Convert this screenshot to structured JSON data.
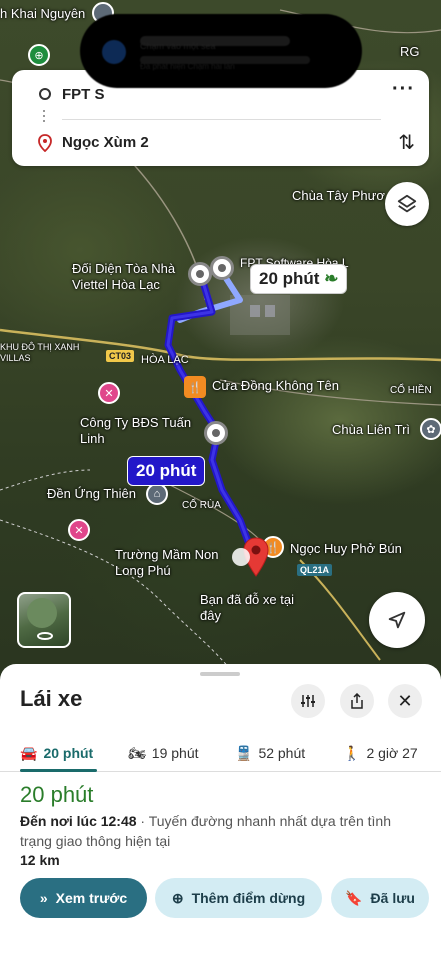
{
  "directions": {
    "origin": "FPT S",
    "destination": "Ngọc Xùm 2"
  },
  "notification": {
    "line1": "Chạm vào một sea",
    "line2": "Đã phát hiện Chạm hai lần"
  },
  "map": {
    "places": {
      "khai_nguyen": "h Khai Nguyên",
      "doi_dien": "Đối Diện Tòa Nhà Viettel Hòa Lạc",
      "fpt_software": "FPT Software Hòa L",
      "chua_tay_phuong": "Chùa Tây Phươ",
      "do_thi": "KHU ĐÔ THỊ XANH VILLAS",
      "hoa_lac": "HÒA LẠC",
      "cua_dong": "Cửa Đồng Không Tên",
      "co_hien": "CỔ HIỀN",
      "bds": "Công Ty BĐS Tuấn Linh",
      "chua_lien_tri": "Chùa Liên Trì",
      "den_ung_thien": "Đền Ứng Thiên",
      "co_rua": "CỔ RÙA",
      "ngoc_huy": "Ngọc Huy Phở Bún",
      "truong_mam_non": "Trường Mầm Non Long Phú",
      "parked": "Bạn đã đỗ xe tại đây",
      "rg": "RG"
    },
    "roads": {
      "ct03": "CT03",
      "ql21a": "QL21A"
    },
    "route_times": {
      "alt": "20 phút",
      "main": "20 phút"
    }
  },
  "sheet": {
    "title": "Lái xe",
    "tabs": [
      {
        "label": "20 phút",
        "icon": "car-icon",
        "active": true
      },
      {
        "label": "19 phút",
        "icon": "motorbike-icon",
        "active": false
      },
      {
        "label": "52 phút",
        "icon": "train-icon",
        "active": false
      },
      {
        "label": "2 giờ 27",
        "icon": "walk-icon",
        "active": false
      }
    ],
    "eta": "20 phút",
    "arrival": "Đến nơi lúc 12:48",
    "route_note": " · Tuyến đường nhanh nhất dựa trên tình trạng giao thông hiện tại",
    "distance": "12 km",
    "buttons": {
      "preview": "Xem trước",
      "add_stop": "Thêm điểm dừng",
      "saved": "Đã lưu"
    }
  },
  "colors": {
    "route_main": "#2317c9",
    "route_alt": "#8fa8ff",
    "accent": "#1a6b6b",
    "eta_green": "#2a7d2a",
    "preview_button": "#2a6f82"
  }
}
